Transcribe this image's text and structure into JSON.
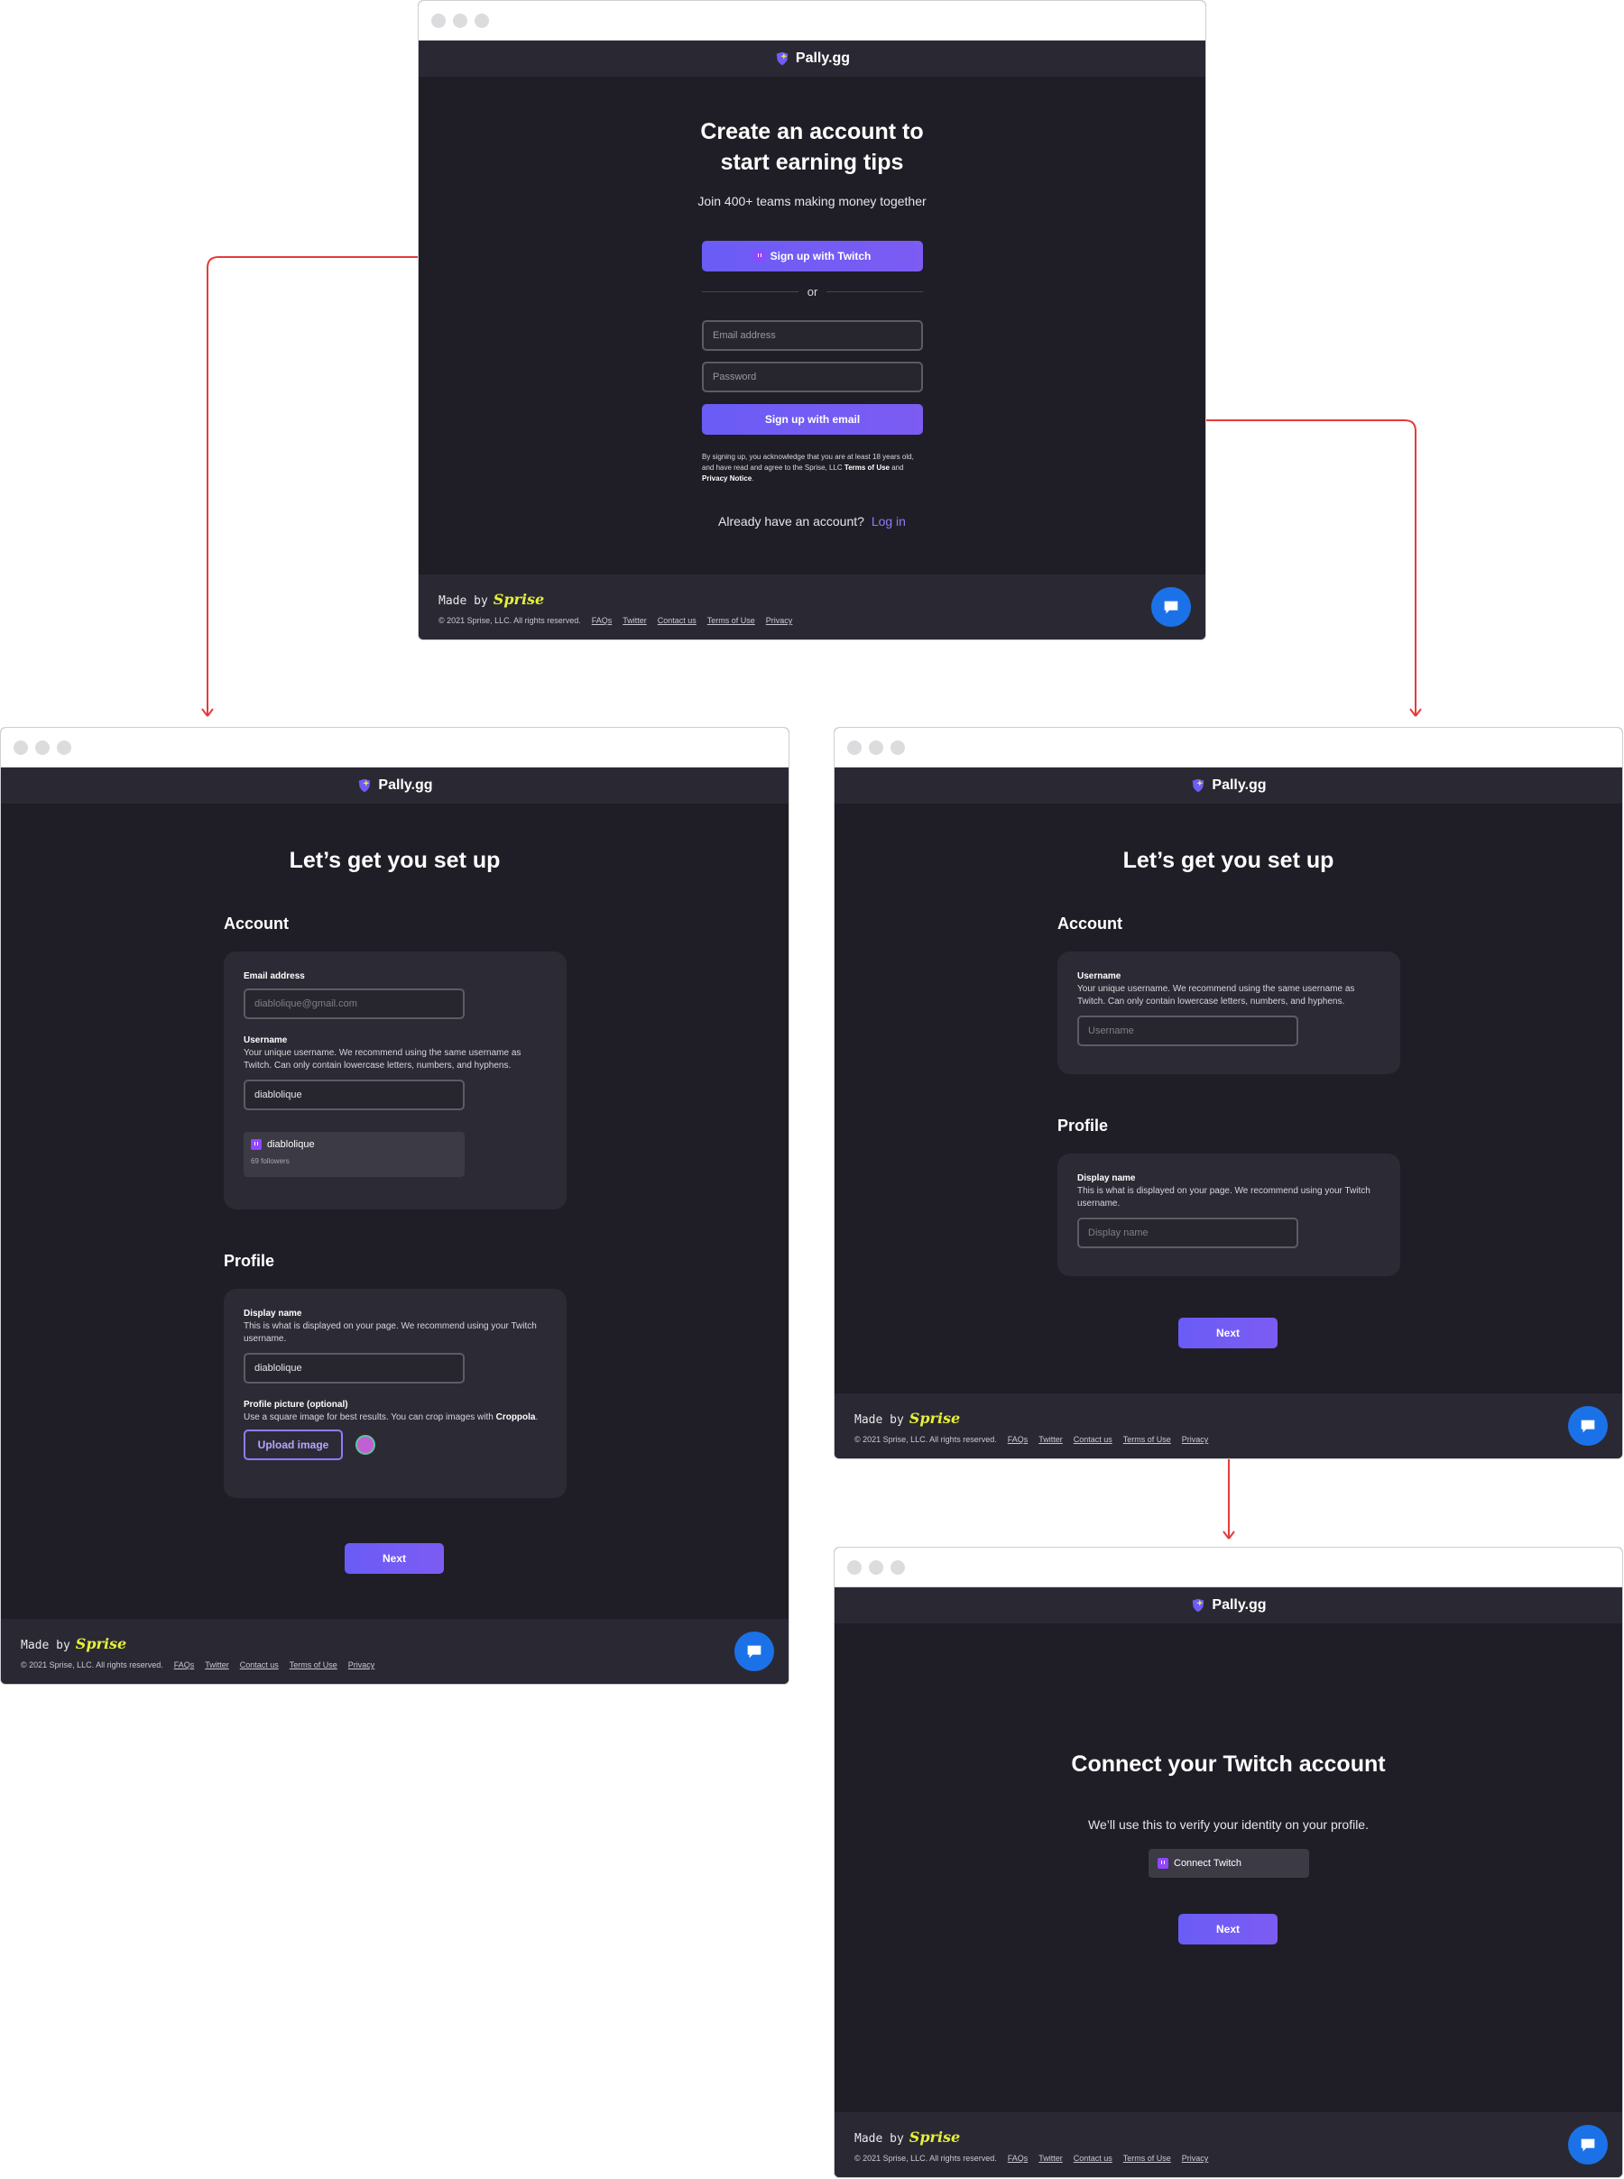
{
  "brand": {
    "name": "Pally.gg"
  },
  "footer": {
    "made_by": "Made by",
    "made_by_brand": "Sprise",
    "copyright": "© 2021 Sprise, LLC. All rights reserved.",
    "links": [
      "FAQs",
      "Twitter",
      "Contact us",
      "Terms of Use",
      "Privacy"
    ]
  },
  "signup": {
    "title_line1": "Create an account to",
    "title_line2": "start earning tips",
    "subtitle": "Join 400+ teams making money together",
    "twitch_button": "Sign up with Twitch",
    "or": "or",
    "email_placeholder": "Email address",
    "password_placeholder": "Password",
    "email_button": "Sign up with email",
    "legal_text": "By signing up, you acknowledge that you are at least 18 years old, and have read and agree to the Sprise, LLC",
    "terms": "Terms of Use",
    "and": "and",
    "privacy": "Privacy Notice",
    "have_account": "Already have an account?",
    "login": "Log in"
  },
  "setup_twitch": {
    "title": "Let’s get you set up",
    "account_heading": "Account",
    "email_label": "Email address",
    "email_placeholder": "diablolique@gmail.com",
    "username_label": "Username",
    "username_help": "Your unique username. We recommend using the same username as Twitch. Can only contain lowercase letters, numbers, and hyphens.",
    "username_value": "diablolique",
    "twitch_name": "diablolique",
    "twitch_followers": "69 followers",
    "profile_heading": "Profile",
    "display_label": "Display name",
    "display_help": "This is what is displayed on your page. We recommend using your Twitch username.",
    "display_value": "diablolique",
    "picture_label": "Profile picture (optional)",
    "picture_help": "Use a square image for best results. You can crop images with",
    "picture_tool": "Croppola",
    "upload_button": "Upload image",
    "next": "Next"
  },
  "setup_email": {
    "title": "Let’s get you set up",
    "account_heading": "Account",
    "username_label": "Username",
    "username_help": "Your unique username. We recommend using the same username as Twitch. Can only contain lowercase letters, numbers, and hyphens.",
    "username_placeholder": "Username",
    "profile_heading": "Profile",
    "display_label": "Display name",
    "display_help": "This is what is displayed on your page. We recommend using your Twitch username.",
    "display_placeholder": "Display name",
    "next": "Next"
  },
  "connect": {
    "title": "Connect your Twitch account",
    "subtitle": "We’ll use this to verify your identity on your profile.",
    "connect_button": "Connect Twitch",
    "next": "Next"
  },
  "colors": {
    "accent": "#6e5cf6",
    "flow_arrow": "#e53b3b",
    "background": "#1f1e26"
  }
}
